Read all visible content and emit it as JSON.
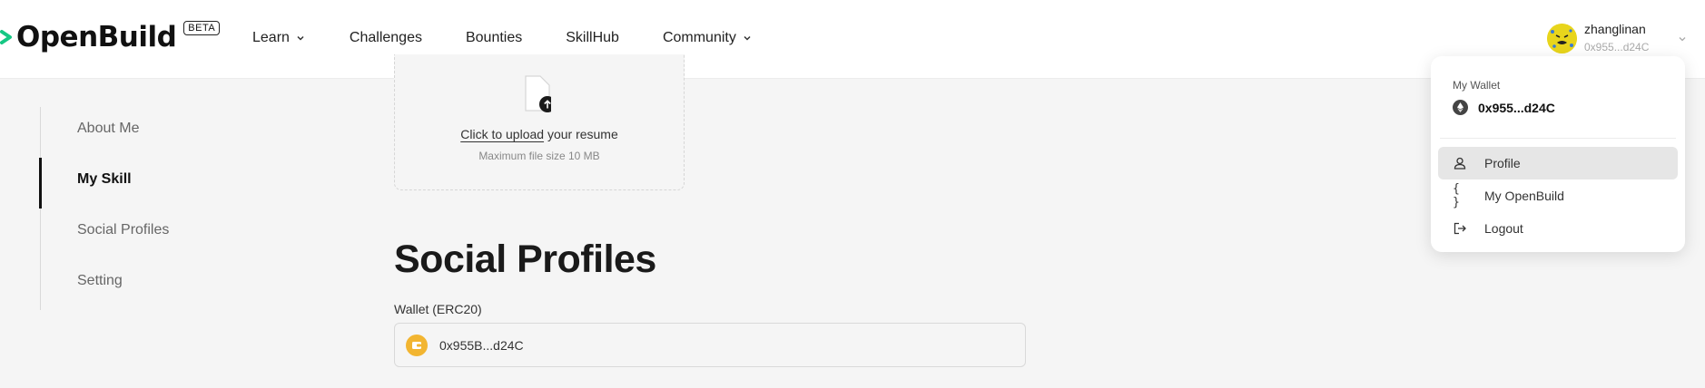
{
  "brand": {
    "name": "OpenBuild",
    "badge": "BETA",
    "accent": "#16c784"
  },
  "nav": {
    "learn": "Learn",
    "challenges": "Challenges",
    "bounties": "Bounties",
    "skillhub": "SkillHub",
    "community": "Community"
  },
  "user": {
    "name": "zhanglinan",
    "address": "0x955...d24C"
  },
  "sidebar": {
    "items": [
      {
        "label": "About Me"
      },
      {
        "label": "My Skill"
      },
      {
        "label": "Social Profiles"
      },
      {
        "label": "Setting"
      }
    ],
    "active": "My Skill"
  },
  "upload": {
    "link": "Click to upload",
    "suffix": " your resume",
    "hint": "Maximum file size 10 MB"
  },
  "social": {
    "title": "Social Profiles",
    "wallet_label": "Wallet (ERC20)",
    "wallet_value": "0x955B...d24C"
  },
  "dropdown": {
    "wallet_label": "My Wallet",
    "wallet_address": "0x955...d24C",
    "items": [
      {
        "label": "Profile",
        "icon": "user-icon"
      },
      {
        "label": "My OpenBuild",
        "icon": "braces-icon"
      },
      {
        "label": "Logout",
        "icon": "logout-icon"
      }
    ]
  }
}
